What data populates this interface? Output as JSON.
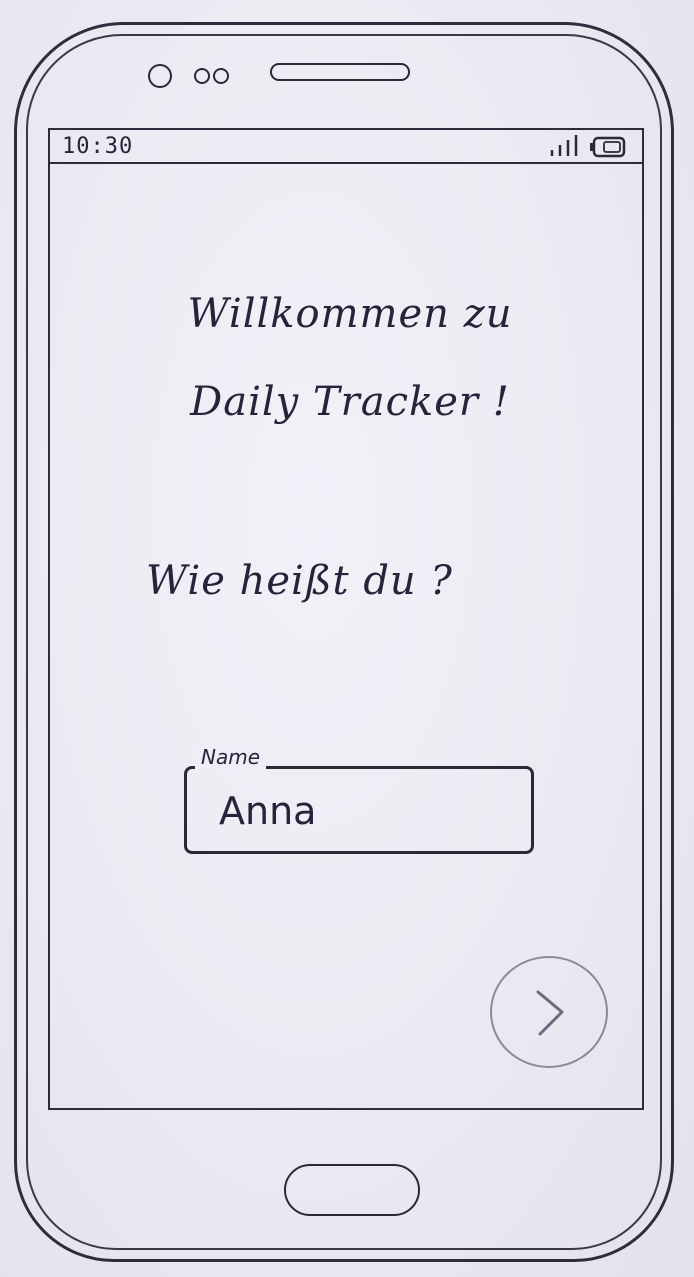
{
  "status_bar": {
    "time": "10:30",
    "signal_icon": "signal-bars-icon",
    "battery_icon": "battery-icon"
  },
  "welcome": {
    "title": "Willkommen zu\nDaily Tracker !"
  },
  "prompt": {
    "question": "Wie heißt du ?"
  },
  "name_field": {
    "label": "Name",
    "value": "Anna"
  },
  "next_button": {
    "icon": "chevron-right-icon"
  },
  "device": {
    "front_camera_icon": "camera-icon",
    "speaker_icon": "speaker-grille-icon",
    "home_button_icon": "home-button-icon"
  },
  "colors": {
    "ink": "#26233a",
    "paper": "#ece9f3",
    "pencil": "#8c899c"
  }
}
